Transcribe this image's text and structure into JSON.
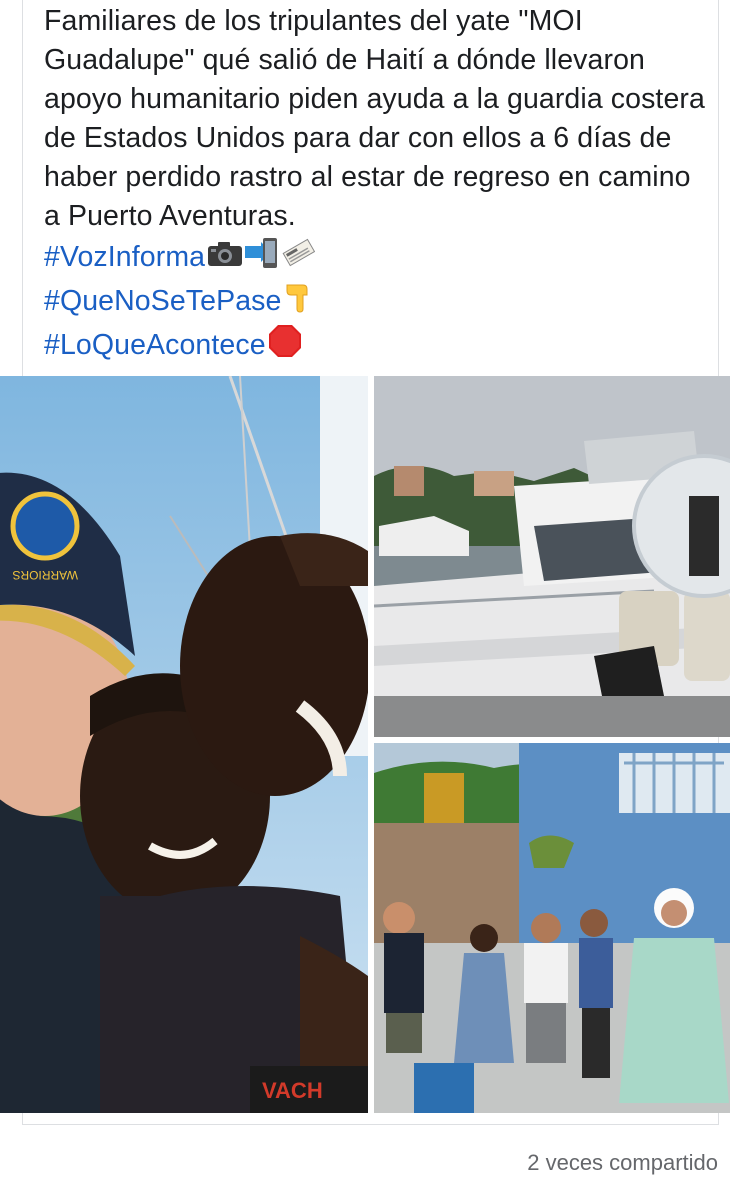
{
  "post": {
    "body": "Familiares de los tripulantes del yate \"MOI Guadalupe\" qué salió de Haití a dónde llevaron apoyo humanitario piden ayuda a la guardia costera de Estados Unidos para dar con ellos a 6 días de haber perdido rastro al estar de regreso en camino a Puerto Aventuras.",
    "hashtags": [
      {
        "text": "#VozInforma",
        "icons": [
          "camera-icon",
          "mobile-arrow-icon",
          "newspaper-icon"
        ]
      },
      {
        "text": "#QueNoSeTePase",
        "icons": [
          "pointing-down-icon"
        ]
      },
      {
        "text": "#LoQueAcontece",
        "icons": [
          "stop-sign-icon"
        ]
      }
    ]
  },
  "photos": {
    "items": [
      {
        "name": "photo-selfie-three-people"
      },
      {
        "name": "photo-white-yacht-marina"
      },
      {
        "name": "photo-group-harbor-delivery"
      }
    ],
    "cap_text": "WARRIORS"
  },
  "footer": {
    "shares": "2 veces compartido"
  },
  "colors": {
    "link": "#1a5fc4",
    "text": "#1c1e21",
    "muted": "#65676b"
  }
}
